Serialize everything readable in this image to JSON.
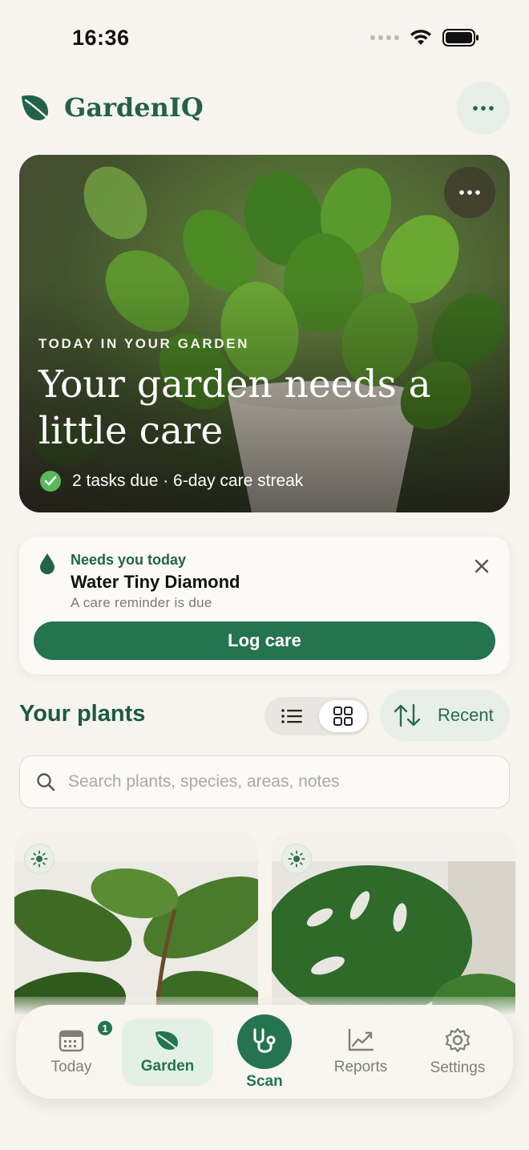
{
  "status_bar": {
    "time": "16:36"
  },
  "app": {
    "name": "GardenIQ"
  },
  "hero": {
    "eyebrow": "TODAY IN YOUR GARDEN",
    "title": "Your garden needs a little care",
    "meta": "2 tasks due · 6-day care streak"
  },
  "reminder": {
    "eyebrow": "Needs you today",
    "title": "Water Tiny Diamond",
    "subtitle": "A care reminder is due",
    "action_label": "Log care"
  },
  "plants": {
    "title": "Your plants",
    "view_mode": "grid",
    "sort_label": "Recent",
    "search_placeholder": "Search plants, species, areas, notes",
    "cards": [
      {
        "icon": "sun-icon"
      },
      {
        "icon": "sun-icon"
      }
    ]
  },
  "tabbar": {
    "active": "Garden",
    "items": [
      {
        "label": "Today",
        "icon": "calendar-icon",
        "badge": "1"
      },
      {
        "label": "Garden",
        "icon": "leaf-icon"
      },
      {
        "label": "Scan",
        "icon": "stethoscope-icon"
      },
      {
        "label": "Reports",
        "icon": "chart-icon"
      },
      {
        "label": "Settings",
        "icon": "gear-icon"
      }
    ]
  },
  "colors": {
    "brand": "#24744f",
    "background": "#f7f4ee",
    "accent_light": "#e3f0e4"
  }
}
